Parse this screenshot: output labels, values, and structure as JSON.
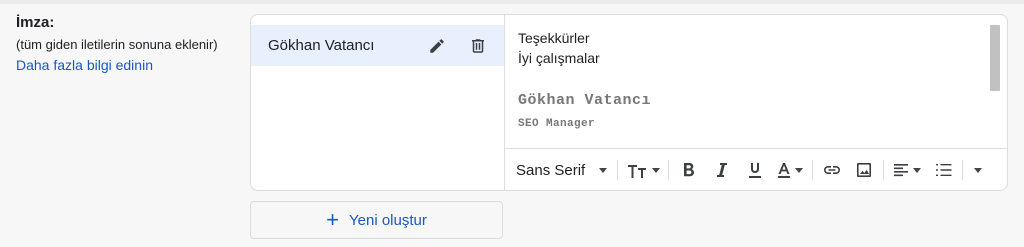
{
  "signature": {
    "title": "İmza:",
    "subtitle": "(tüm giden iletilerin sonuna eklenir)",
    "learn_more": "Daha fazla bilgi edinin"
  },
  "list": {
    "items": [
      {
        "name": "Gökhan Vatancı",
        "selected": true
      }
    ]
  },
  "editor": {
    "line1": "Teşekkürler",
    "line2": "İyi çalışmalar",
    "sig_name": "Gökhan Vatancı",
    "sig_role": "SEO Manager",
    "font_select": "Sans Serif",
    "icons": [
      "text-size-icon",
      "bold-icon",
      "italic-icon",
      "underline-icon",
      "text-color-icon",
      "link-icon",
      "image-icon",
      "align-icon",
      "list-icon",
      "more-icon",
      "pencil-icon",
      "trash-icon",
      "plus-icon"
    ]
  },
  "new_button": {
    "plus": "+",
    "label": "Yeni oluştur"
  }
}
